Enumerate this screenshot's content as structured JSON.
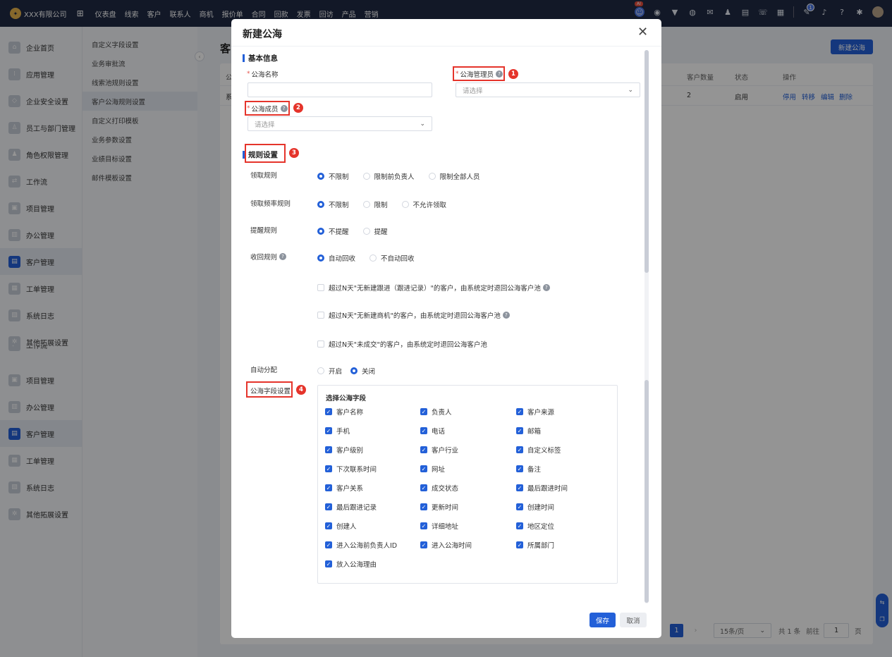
{
  "topbar": {
    "company": "XXX有限公司",
    "nav": [
      "仪表盘",
      "线索",
      "客户",
      "联系人",
      "商机",
      "报价单",
      "合同",
      "回款",
      "发票",
      "回访",
      "产品",
      "营销"
    ],
    "ai_badge": "AI",
    "notify_count": "1"
  },
  "sidebar": {
    "items": [
      {
        "label": "企业首页",
        "icon": "home-icon"
      },
      {
        "label": "应用管理",
        "icon": "apps-icon"
      },
      {
        "label": "企业安全设置",
        "icon": "shield-icon"
      },
      {
        "label": "员工与部门管理",
        "icon": "users-icon"
      },
      {
        "label": "角色权限管理",
        "icon": "user-role-icon"
      },
      {
        "label": "工作流",
        "icon": "workflow-icon"
      },
      {
        "label": "项目管理",
        "icon": "project-icon"
      },
      {
        "label": "办公管理",
        "icon": "office-icon"
      },
      {
        "label": "客户管理",
        "icon": "customer-icon"
      },
      {
        "label": "工单管理",
        "icon": "ticket-icon"
      },
      {
        "label": "系统日志",
        "icon": "log-icon"
      },
      {
        "label": "其他拓展设置",
        "icon": "extension-icon"
      }
    ],
    "items_repeat": [
      {
        "label": "项目管理"
      },
      {
        "label": "办公管理"
      },
      {
        "label": "客户管理"
      },
      {
        "label": "工单管理"
      },
      {
        "label": "系统日志"
      },
      {
        "label": "其他拓展设置"
      }
    ]
  },
  "submenu": {
    "items": [
      "自定义字段设置",
      "业务审批流",
      "线索池规则设置",
      "客户公海规则设置",
      "自定义打印模板",
      "业务参数设置",
      "业绩目标设置",
      "邮件模板设置"
    ]
  },
  "main": {
    "title": "客",
    "new_button": "新建公海",
    "columns": [
      "公",
      "客户数量",
      "状态",
      "操作"
    ],
    "row": {
      "name": "系",
      "count": "2",
      "status": "启用",
      "actions": [
        "停用",
        "转移",
        "编辑",
        "删除"
      ]
    },
    "pager": {
      "current": "1",
      "next": "›",
      "page_size": "15条/页",
      "total": "共 1 条",
      "goto": "前往",
      "goto_value": "1",
      "page_unit": "页"
    },
    "float_tools": [
      "⇆",
      "❐"
    ]
  },
  "modal": {
    "title": "新建公海",
    "basic_section": "基本信息",
    "name_label": "公海名称",
    "manager_label": "公海管理员",
    "manager_placeholder": "请选择",
    "member_label": "公海成员",
    "member_placeholder": "请选择",
    "rules_section": "规则设置",
    "rules": [
      {
        "label": "领取规则",
        "options": [
          "不限制",
          "限制前负责人",
          "限制全部人员"
        ],
        "selected": 0
      },
      {
        "label": "领取频率规则",
        "options": [
          "不限制",
          "限制",
          "不允许领取"
        ],
        "selected": 0
      },
      {
        "label": "提醒规则",
        "options": [
          "不提醒",
          "提醒"
        ],
        "selected": 0
      },
      {
        "label": "收回规则",
        "options": [
          "自动回收",
          "不自动回收"
        ],
        "selected": 0
      }
    ],
    "recycle_conditions": [
      "超过N天\"无新建跟进（跟进记录）\"的客户，由系统定时退回公海客户池",
      "超过N天\"无新建商机\"的客户，由系统定时退回公海客户池",
      "超过N天\"未成交\"的客户，由系统定时退回公海客户池"
    ],
    "auto_assign": {
      "label": "自动分配",
      "options": [
        "开启",
        "关闭"
      ],
      "selected": 1
    },
    "fields_label": "公海字段设置",
    "fields_title": "选择公海字段",
    "fields": [
      "客户名称",
      "负责人",
      "客户来源",
      "手机",
      "电话",
      "邮箱",
      "客户级别",
      "客户行业",
      "自定义标签",
      "下次联系时间",
      "网址",
      "备注",
      "客户关系",
      "成交状态",
      "最后跟进时间",
      "最后跟进记录",
      "更新时间",
      "创建时间",
      "创建人",
      "详细地址",
      "地区定位",
      "进入公海前负责人ID",
      "进入公海时间",
      "所属部门",
      "放入公海理由"
    ],
    "save": "保存",
    "cancel": "取消",
    "markers": [
      "1",
      "2",
      "3",
      "4"
    ]
  },
  "colors": {
    "accent": "#2360d8",
    "topbar": "#1f2a44",
    "highlight": "#e5342b"
  }
}
